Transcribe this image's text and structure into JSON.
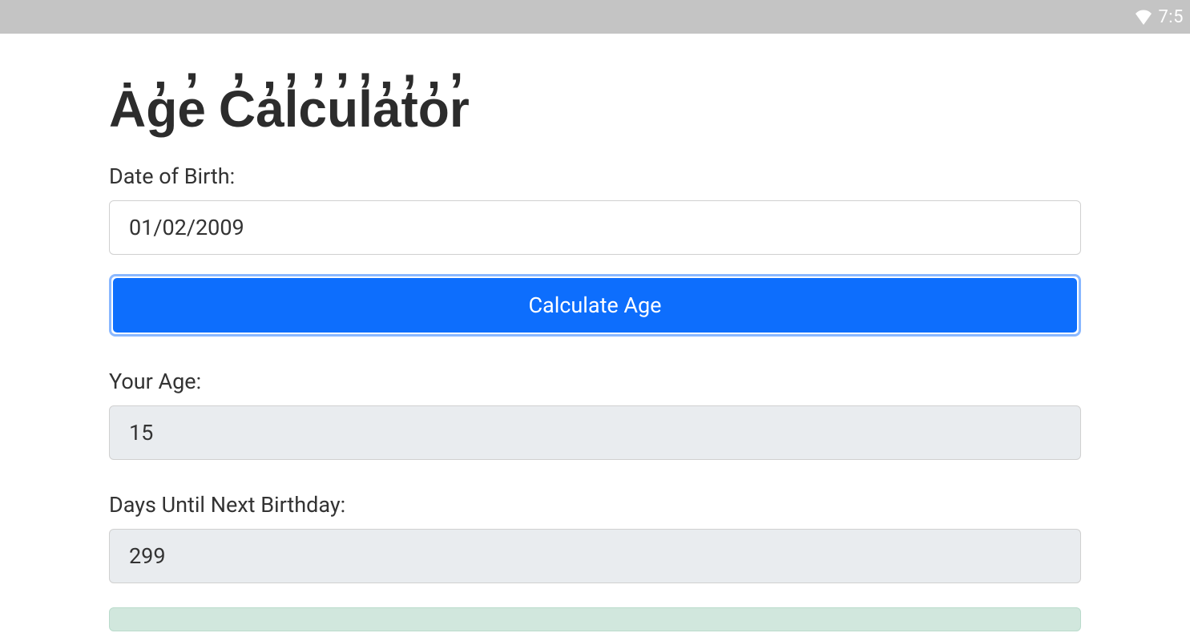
{
  "status_bar": {
    "clock": "7:5"
  },
  "page": {
    "title": "Ȧg̓e̓ C̓a̓l̓c̓u̓l̓a̓t̓o̓r̓"
  },
  "form": {
    "dob_label": "Date of Birth:",
    "dob_value": "01/02/2009",
    "calculate_label": "Calculate Age",
    "age_label": "Your Age:",
    "age_value": "15",
    "days_label": "Days Until Next Birthday:",
    "days_value": "299"
  }
}
